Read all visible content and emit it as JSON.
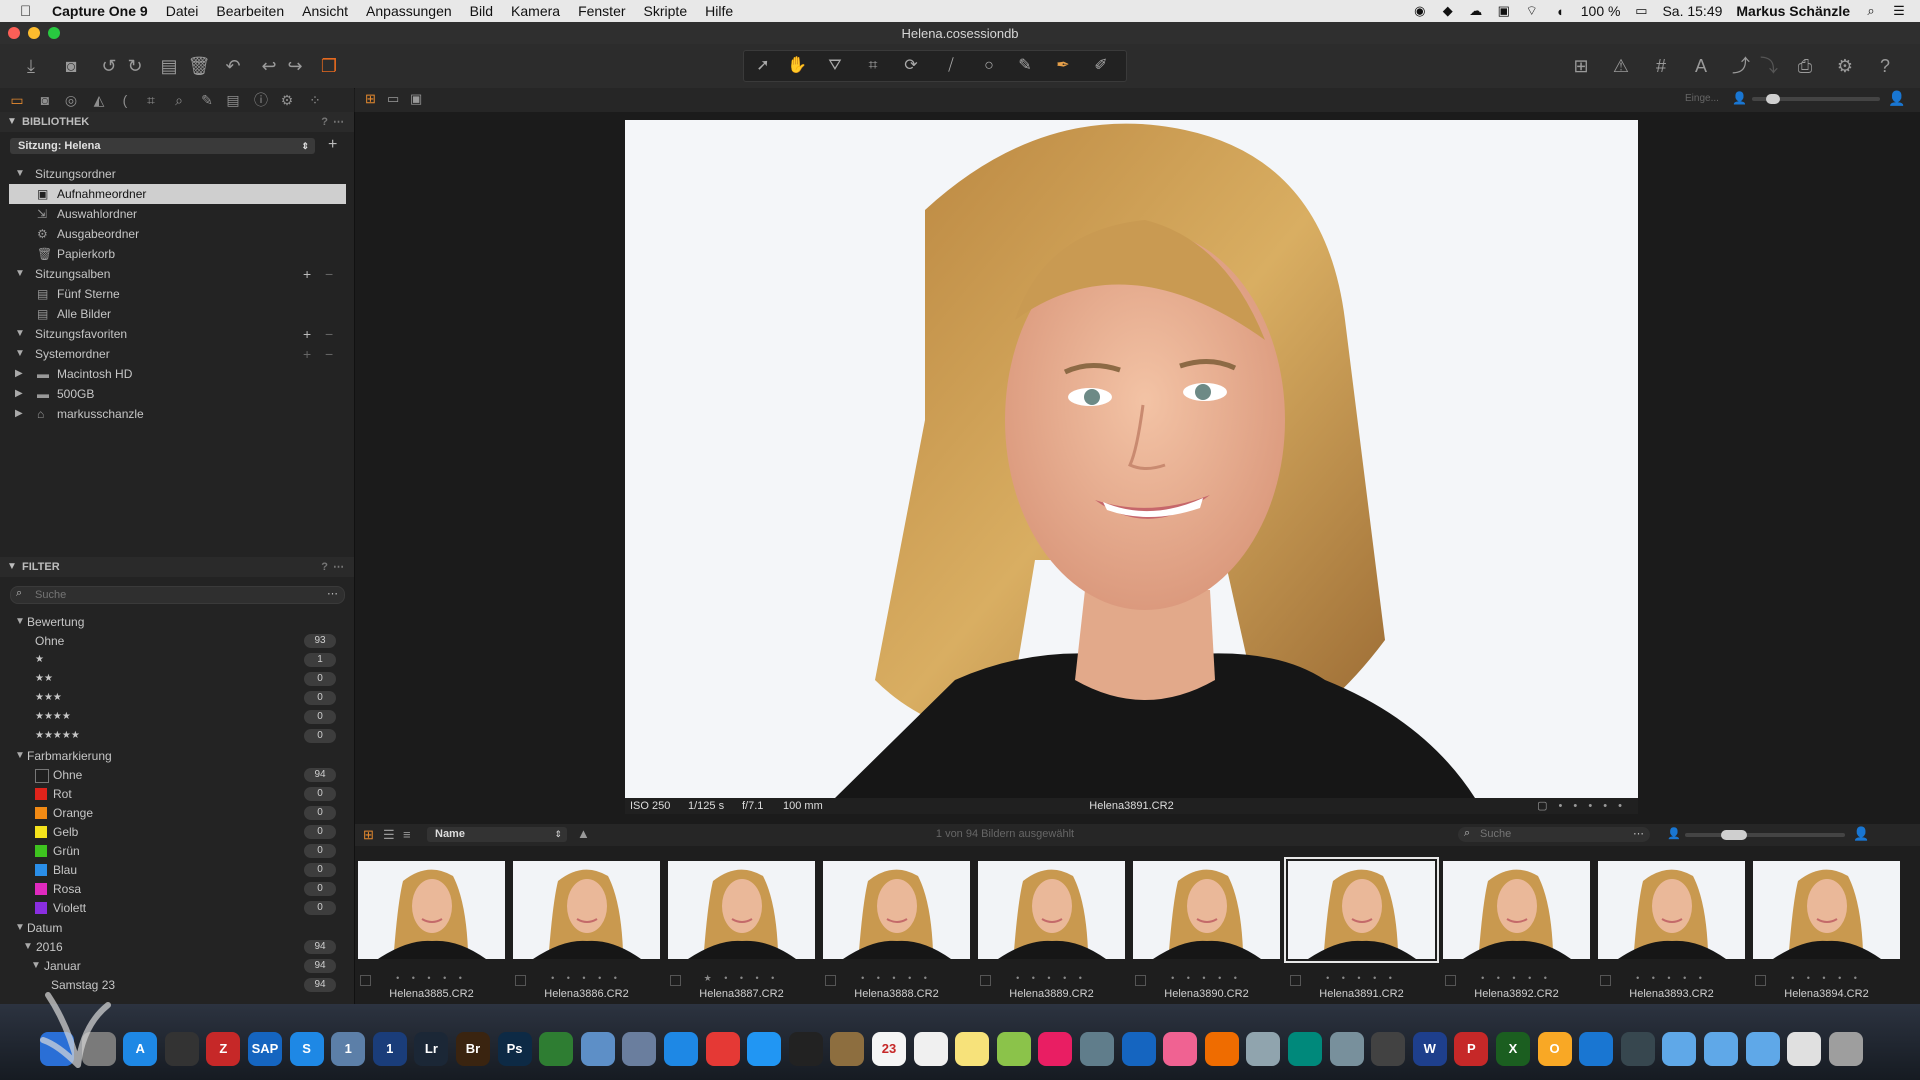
{
  "menubar": {
    "app_name": "Capture One 9",
    "items": [
      "Datei",
      "Bearbeiten",
      "Ansicht",
      "Anpassungen",
      "Bild",
      "Kamera",
      "Fenster",
      "Skripte",
      "Hilfe"
    ],
    "battery": "100 %",
    "clock": "Sa. 15:49",
    "user": "Markus Schänzle"
  },
  "window": {
    "title": "Helena.cosessiondb"
  },
  "library": {
    "section_title": "BIBLIOTHEK",
    "help": "?",
    "session_select": "Sitzung: Helena",
    "groups": {
      "session_folders": {
        "label": "Sitzungsordner",
        "items": [
          "Aufnahmeordner",
          "Auswahlordner",
          "Ausgabeordner",
          "Papierkorb"
        ]
      },
      "session_albums": {
        "label": "Sitzungsalben",
        "items": [
          "Fünf Sterne",
          "Alle Bilder"
        ]
      },
      "session_favorites": {
        "label": "Sitzungsfavoriten"
      },
      "system_folders": {
        "label": "Systemordner",
        "items": [
          "Macintosh HD",
          "500GB",
          "markusschanzle"
        ]
      }
    }
  },
  "filter": {
    "section_title": "FILTER",
    "help": "?",
    "search_placeholder": "Suche",
    "rating": {
      "label": "Bewertung",
      "items": [
        {
          "label": "Ohne",
          "count": "93"
        },
        {
          "label": "★",
          "count": "1"
        },
        {
          "label": "★★",
          "count": "0"
        },
        {
          "label": "★★★",
          "count": "0"
        },
        {
          "label": "★★★★",
          "count": "0"
        },
        {
          "label": "★★★★★",
          "count": "0"
        }
      ]
    },
    "color_tag": {
      "label": "Farbmarkierung",
      "items": [
        {
          "label": "Ohne",
          "count": "94",
          "color": "#1f1f1f"
        },
        {
          "label": "Rot",
          "count": "0",
          "color": "#e0231b"
        },
        {
          "label": "Orange",
          "count": "0",
          "color": "#f28a14"
        },
        {
          "label": "Gelb",
          "count": "0",
          "color": "#f5e31c"
        },
        {
          "label": "Grün",
          "count": "0",
          "color": "#3ec31f"
        },
        {
          "label": "Blau",
          "count": "0",
          "color": "#2a8ee8"
        },
        {
          "label": "Rosa",
          "count": "0",
          "color": "#e02abf"
        },
        {
          "label": "Violett",
          "count": "0",
          "color": "#8a2ee0"
        }
      ]
    },
    "date": {
      "label": "Datum",
      "year": {
        "label": "2016",
        "count": "94"
      },
      "month": {
        "label": "Januar",
        "count": "94"
      },
      "day": {
        "label": "Samstag 23",
        "count": "94"
      }
    }
  },
  "viewer": {
    "proof_label": "Einge...",
    "info": {
      "iso": "ISO 250",
      "shutter": "1/125 s",
      "aperture": "f/7.1",
      "focal": "100 mm",
      "filename": "Helena3891.CR2"
    }
  },
  "browser": {
    "sort": "Name",
    "selection_status": "1 von 94 Bildern ausgewählt",
    "search_placeholder": "Suche",
    "thumbnails": [
      {
        "name": "Helena3885.CR2",
        "stars": "• • • • •"
      },
      {
        "name": "Helena3886.CR2",
        "stars": "• • • • •"
      },
      {
        "name": "Helena3887.CR2",
        "stars": "★ • • • •"
      },
      {
        "name": "Helena3888.CR2",
        "stars": "• • • • •"
      },
      {
        "name": "Helena3889.CR2",
        "stars": "• • • • •"
      },
      {
        "name": "Helena3890.CR2",
        "stars": "• • • • •"
      },
      {
        "name": "Helena3891.CR2",
        "stars": "• • • • •"
      },
      {
        "name": "Helena3892.CR2",
        "stars": "• • • • •"
      },
      {
        "name": "Helena3893.CR2",
        "stars": "• • • • •"
      },
      {
        "name": "Helena3894.CR2",
        "stars": "• • • • •"
      }
    ]
  },
  "dock": {
    "apps": [
      {
        "label": "",
        "color": "#2a6fd6"
      },
      {
        "label": "",
        "color": "#7a7a7a"
      },
      {
        "label": "A",
        "color": "#1e88e5"
      },
      {
        "label": "",
        "color": "#333333"
      },
      {
        "label": "Z",
        "color": "#c62828"
      },
      {
        "label": "SAP",
        "color": "#1565c0"
      },
      {
        "label": "S",
        "color": "#1e88e5"
      },
      {
        "label": "1",
        "color": "#5c7fa8"
      },
      {
        "label": "1",
        "color": "#1a3d7a"
      },
      {
        "label": "Lr",
        "color": "#1b2736"
      },
      {
        "label": "Br",
        "color": "#3a2410"
      },
      {
        "label": "Ps",
        "color": "#0d2a45"
      },
      {
        "label": "",
        "color": "#2e7d32"
      },
      {
        "label": "",
        "color": "#5d8fc7"
      },
      {
        "label": "",
        "color": "#6a7e9e"
      },
      {
        "label": "",
        "color": "#1e88e5"
      },
      {
        "label": "",
        "color": "#e53935"
      },
      {
        "label": "",
        "color": "#2196f3"
      },
      {
        "label": "",
        "color": "#222222"
      },
      {
        "label": "",
        "color": "#8d6e3f"
      },
      {
        "label": "23",
        "color": "#f5f5f5"
      },
      {
        "label": "",
        "color": "#f0f0f0"
      },
      {
        "label": "",
        "color": "#f7e27a"
      },
      {
        "label": "",
        "color": "#8bc34a"
      },
      {
        "label": "",
        "color": "#e91e63"
      },
      {
        "label": "",
        "color": "#607d8b"
      },
      {
        "label": "",
        "color": "#1565c0"
      },
      {
        "label": "",
        "color": "#f06292"
      },
      {
        "label": "",
        "color": "#ef6c00"
      },
      {
        "label": "",
        "color": "#90a4ae"
      },
      {
        "label": "",
        "color": "#00897b"
      },
      {
        "label": "",
        "color": "#78909c"
      },
      {
        "label": "",
        "color": "#424242"
      },
      {
        "label": "W",
        "color": "#1e3f8c"
      },
      {
        "label": "P",
        "color": "#c62828"
      },
      {
        "label": "X",
        "color": "#1b5e20"
      },
      {
        "label": "O",
        "color": "#f9a825"
      },
      {
        "label": "",
        "color": "#1976d2"
      },
      {
        "label": "",
        "color": "#37474f"
      },
      {
        "label": "",
        "color": "#5fa8e8"
      },
      {
        "label": "",
        "color": "#5fa8e8"
      },
      {
        "label": "",
        "color": "#5fa8e8"
      },
      {
        "label": "",
        "color": "#e0e0e0"
      },
      {
        "label": "",
        "color": "#9e9e9e"
      }
    ]
  }
}
